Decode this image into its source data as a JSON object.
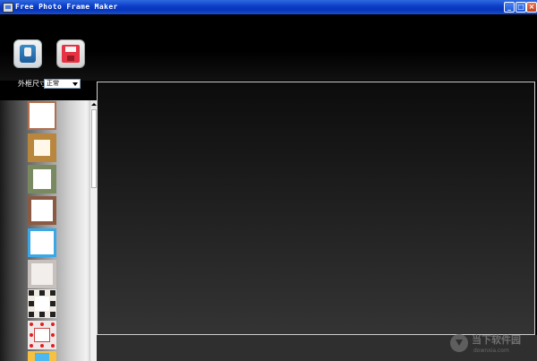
{
  "window": {
    "title": "Free Photo Frame Maker",
    "controls": {
      "minimize": "_",
      "maximize": "□",
      "close": "×"
    }
  },
  "toolbar": {
    "open_icon": "open-photo-icon",
    "save_icon": "save-icon",
    "frame_size_label": "外框尺寸:",
    "frame_size_value": "正常"
  },
  "frames": {
    "items": [
      {
        "name": "frame-wood-thin",
        "color": "#b07050"
      },
      {
        "name": "frame-gold",
        "color": "#b8863c"
      },
      {
        "name": "frame-green-ornate",
        "color": "#7a8a60"
      },
      {
        "name": "frame-brown-dotted",
        "color": "#8a5a44"
      },
      {
        "name": "frame-blue",
        "color": "#3aa8e8"
      },
      {
        "name": "frame-gray-dotted",
        "color": "#c8c0bc"
      },
      {
        "name": "frame-black-squares",
        "color": "#f0ece4"
      },
      {
        "name": "frame-hearts",
        "color": "#f0e8e8"
      },
      {
        "name": "frame-cartoon",
        "color": "#f6c040"
      }
    ]
  },
  "watermark": {
    "title": "当下软件园",
    "url": "downxia.com"
  }
}
